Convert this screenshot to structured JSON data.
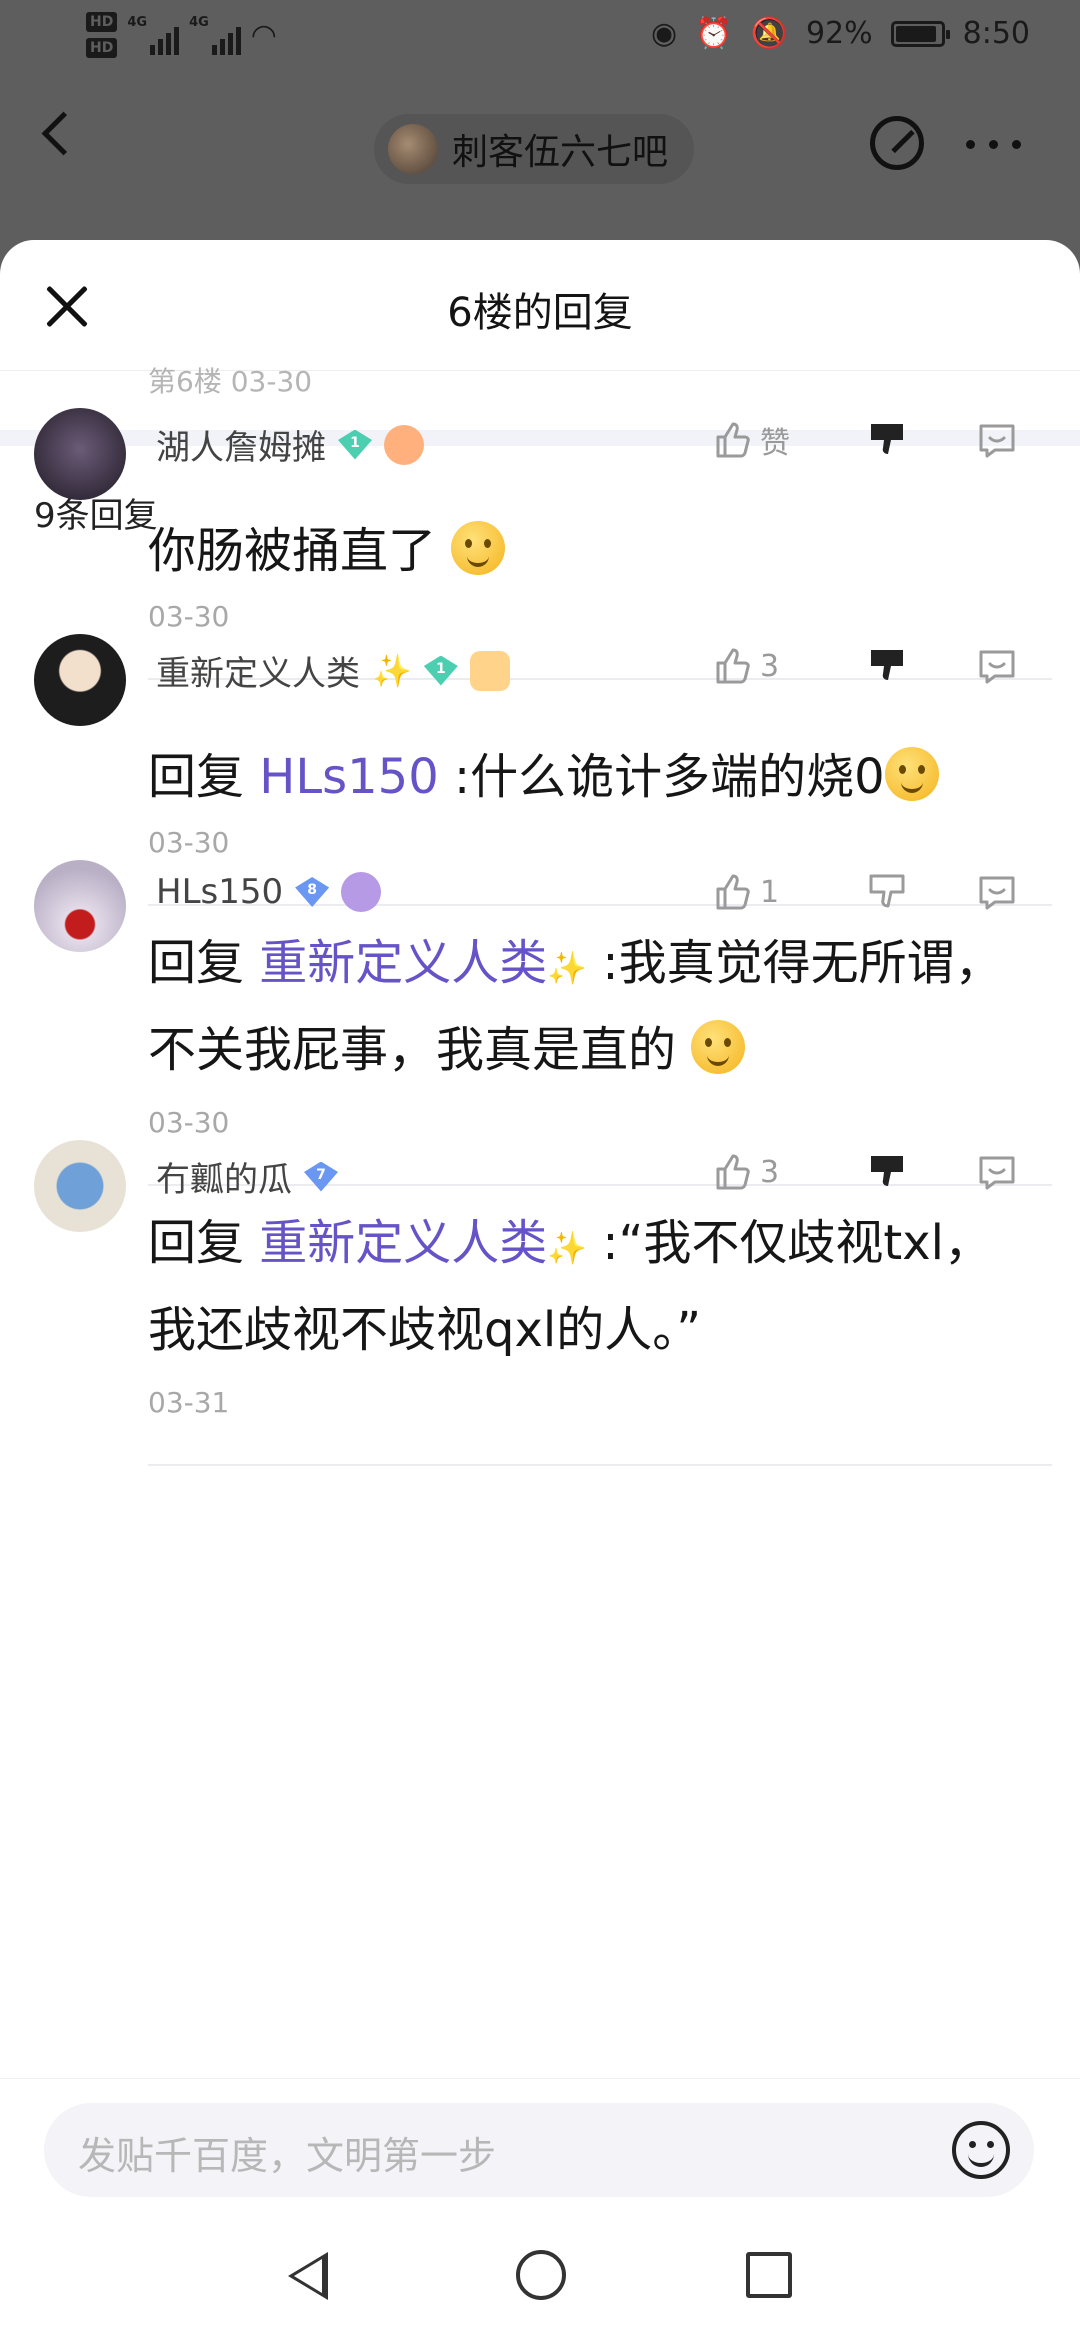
{
  "status_bar": {
    "network": "4G",
    "battery": "92%",
    "battery_level": 0.92,
    "time": "8:50"
  },
  "background_nav": {
    "forum_name": "刺客伍六七吧"
  },
  "sheet": {
    "title": "6楼的回复",
    "floor_meta": "第6楼  03-30",
    "reply_count": "9条回复"
  },
  "comments": [
    {
      "user": "湖人詹姆摊",
      "level": "1",
      "like_label": "赞",
      "mention": "",
      "text": "你肠被捅直了",
      "date": "03-30"
    },
    {
      "user": "重新定义人类",
      "level": "1",
      "like_label": "3",
      "mention": "HLs150",
      "text": ":什么诡计多端的烧0",
      "date": "03-30"
    },
    {
      "user": "HLs150",
      "level": "8",
      "like_label": "1",
      "mention": "重新定义人类",
      "text": ":我真觉得无所谓，不关我屁事，我真是直的",
      "date": "03-30"
    },
    {
      "user": "冇瓤的瓜",
      "level": "7",
      "like_label": "3",
      "mention": "重新定义人类",
      "text": ":“我不仅歧视txl，我还歧视不歧视qxl的人。”",
      "date": "03-31"
    }
  ],
  "reply_prefix": "回复 ",
  "input": {
    "placeholder": "发贴千百度，文明第一步"
  },
  "colors": {
    "mention": "#6653c7",
    "level_badge": "#4ccfb0",
    "level_badge_blue": "#6a97f2"
  }
}
